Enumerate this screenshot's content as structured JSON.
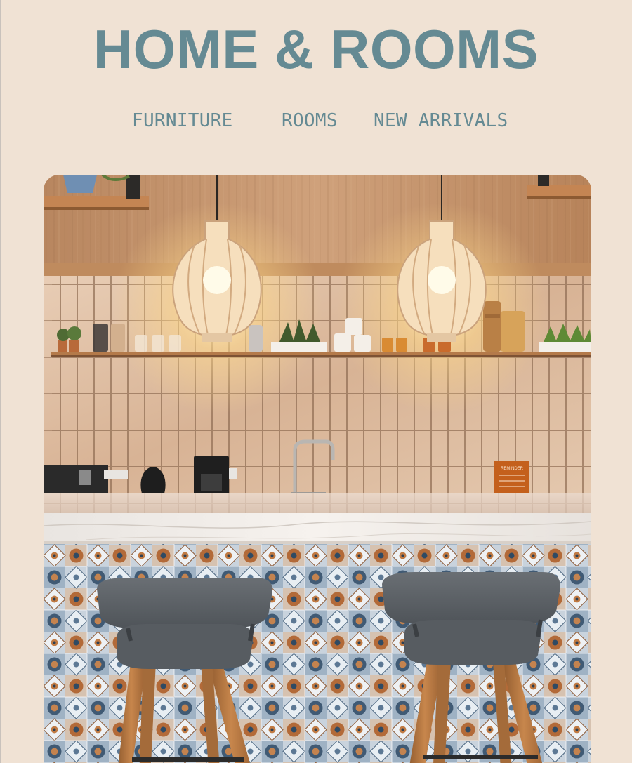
{
  "header": {
    "title": "HOME & ROOMS"
  },
  "nav": {
    "items": [
      {
        "label": "FURNITURE"
      },
      {
        "label": "ROOMS"
      },
      {
        "label": "NEW ARRIVALS"
      }
    ]
  },
  "hero": {
    "sign_text": "REMINDER"
  },
  "colors": {
    "background": "#f0e2d4",
    "accent": "#658a93",
    "wood": "#c99c77",
    "marble": "#f1ece6",
    "stool_seat": "#5c6165",
    "stool_leg": "#b97a44"
  }
}
